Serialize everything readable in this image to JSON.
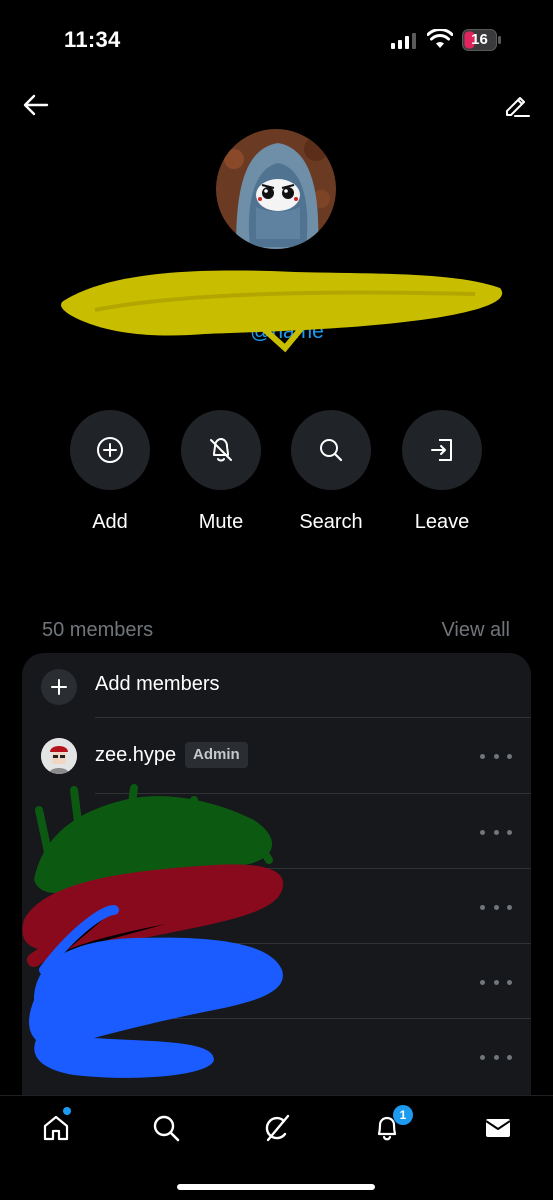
{
  "status_bar": {
    "time": "11:34",
    "battery": "16"
  },
  "group": {
    "username": "@name"
  },
  "actions": [
    {
      "label": "Add"
    },
    {
      "label": "Mute"
    },
    {
      "label": "Search"
    },
    {
      "label": "Leave"
    }
  ],
  "members_section": {
    "count_label": "50 members",
    "view_all": "View all",
    "add_members": "Add members",
    "members": [
      {
        "name": "zee.hype",
        "badge": "Admin"
      }
    ]
  },
  "tab_bar": {
    "notifications_badge": "1"
  },
  "colors": {
    "accent": "#1d9bf0",
    "battery_low": "#e0245e",
    "redaction_yellow": "#c9bd00",
    "redaction_green": "#0c5a12",
    "redaction_red": "#8a0a1d",
    "redaction_blue": "#1a5cff"
  },
  "icons": {
    "back": "arrow-left-icon",
    "edit": "pencil-icon",
    "add": "plus-circle-icon",
    "mute": "bell-slash-icon",
    "search": "magnifier-icon",
    "leave": "exit-door-icon",
    "more": "ellipsis-icon",
    "tabs": [
      "home-icon",
      "search-icon",
      "grok-icon",
      "bell-icon",
      "mail-icon"
    ]
  }
}
